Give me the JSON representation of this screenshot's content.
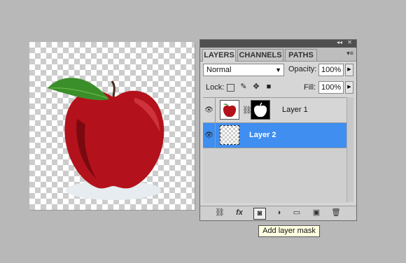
{
  "panel": {
    "tabs": [
      "LAYERS",
      "CHANNELS",
      "PATHS"
    ],
    "blend_mode": "Normal",
    "opacity_label": "Opacity:",
    "opacity_value": "100%",
    "lock_label": "Lock:",
    "fill_label": "Fill:",
    "fill_value": "100%",
    "layers": [
      {
        "name": "Layer 1",
        "selected": false
      },
      {
        "name": "Layer 2",
        "selected": true
      }
    ]
  },
  "tooltip": "Add layer mask",
  "colors": {
    "selected_layer": "#3f8ef0",
    "arrow": "#e8232e",
    "apple": "#b3121c",
    "leaf": "#3a8f2a"
  },
  "icons": [
    "eye-icon",
    "link-icon",
    "fx-icon",
    "layer-mask-icon",
    "adjustment-icon",
    "folder-icon",
    "new-layer-icon",
    "trash-icon"
  ]
}
